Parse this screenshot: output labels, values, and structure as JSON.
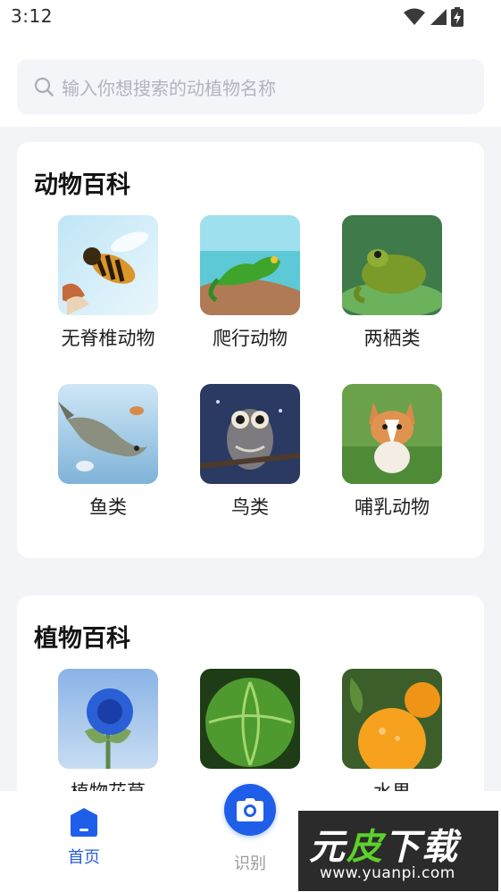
{
  "status_bar": {
    "time": "3:12",
    "icons": [
      "wifi-icon",
      "signal-icon",
      "battery-charging-icon"
    ]
  },
  "search": {
    "placeholder": "输入你想搜索的动植物名称",
    "icon": "search-icon"
  },
  "animals": {
    "title": "动物百科",
    "items": [
      {
        "label": "无脊椎动物",
        "image": "bee"
      },
      {
        "label": "爬行动物",
        "image": "lizard"
      },
      {
        "label": "两栖类",
        "image": "frog"
      },
      {
        "label": "鱼类",
        "image": "fish"
      },
      {
        "label": "鸟类",
        "image": "owl"
      },
      {
        "label": "哺乳动物",
        "image": "corgi"
      }
    ]
  },
  "plants": {
    "title": "植物百科",
    "items": [
      {
        "label": "植物花草",
        "image": "blue-flower"
      },
      {
        "label": "",
        "image": "cabbage"
      },
      {
        "label": "水果",
        "image": "orange"
      }
    ]
  },
  "bottom_nav": {
    "home": {
      "label": "首页",
      "icon": "home-icon"
    },
    "recognize": {
      "label": "识别",
      "icon": "camera-icon"
    }
  },
  "watermark": {
    "text_white": "元",
    "text_green": "皮",
    "text_rest": "下载",
    "url": "www.yuanpi.com"
  },
  "colors": {
    "accent": "#1f5ee8",
    "active_nav": "#2a5bdc",
    "background": "#f3f4f8"
  }
}
